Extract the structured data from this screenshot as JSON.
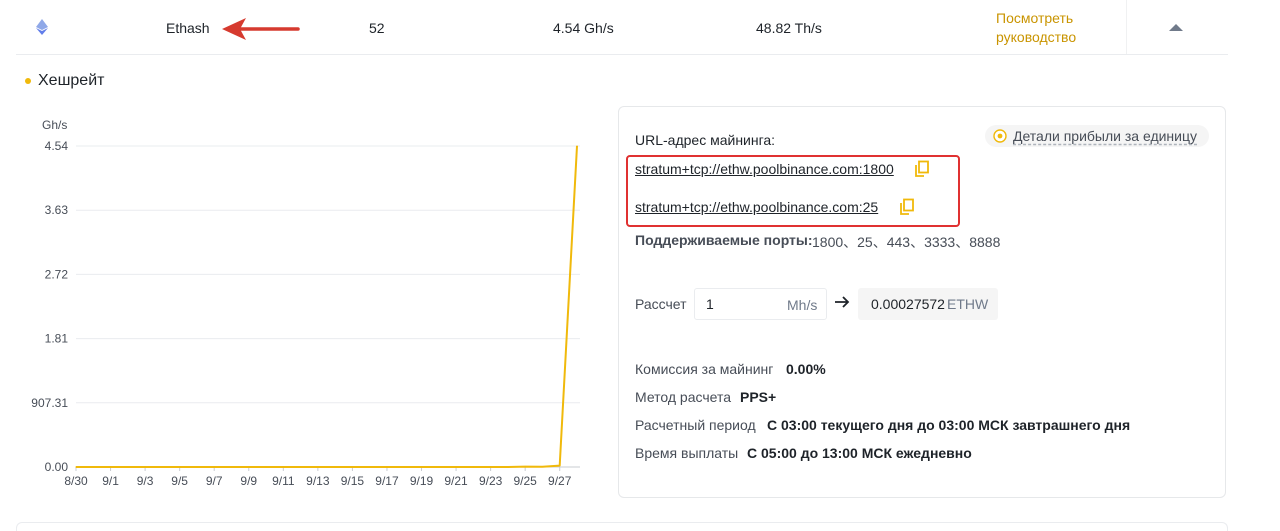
{
  "top_row": {
    "coin_icon": "ethereum-icon",
    "algorithm": "Ethash",
    "workers": "52",
    "hashrate": "4.54 Gh/s",
    "pool_hashrate": "48.82 Th/s",
    "guide_link": "Посмотреть руководство",
    "collapse_icon": "caret-up-icon"
  },
  "section": {
    "title": "Хешрейт"
  },
  "chart_data": {
    "type": "line",
    "ylabel": "Gh/s",
    "y_ticks": [
      "4.54",
      "3.63",
      "2.72",
      "1.81",
      "907.31",
      "0.00"
    ],
    "x_ticks": [
      "8/30",
      "9/1",
      "9/3",
      "9/5",
      "9/7",
      "9/9",
      "9/11",
      "9/13",
      "9/15",
      "9/17",
      "9/19",
      "9/21",
      "9/23",
      "9/25",
      "9/27"
    ],
    "x": [
      "8/30",
      "8/31",
      "9/1",
      "9/2",
      "9/3",
      "9/4",
      "9/5",
      "9/6",
      "9/7",
      "9/8",
      "9/9",
      "9/10",
      "9/11",
      "9/12",
      "9/13",
      "9/14",
      "9/15",
      "9/16",
      "9/17",
      "9/18",
      "9/19",
      "9/20",
      "9/21",
      "9/22",
      "9/23",
      "9/24",
      "9/25",
      "9/26",
      "9/27",
      "9/28"
    ],
    "series": [
      {
        "values": [
          0,
          0,
          0,
          0,
          0,
          0,
          0,
          0,
          0,
          0,
          0,
          0,
          0,
          0,
          0,
          0,
          0,
          0,
          0,
          0,
          0,
          0,
          0,
          0,
          0,
          0,
          0.005,
          0.003,
          0.02,
          4.54
        ],
        "color": "#f0b90b"
      }
    ],
    "ylim": [
      0,
      4.54
    ],
    "grid": true
  },
  "panel": {
    "url_label": "URL-адрес майнинга:",
    "urls": [
      "stratum+tcp://ethw.poolbinance.com:1800",
      "stratum+tcp://ethw.poolbinance.com:25"
    ],
    "ports_label": "Поддерживаемые порты:",
    "ports_value": "1800、25、443、3333、8888",
    "profit_link": "Детали прибыли за единицу",
    "calc_label": "Рассчет",
    "calc_input_value": "1",
    "calc_unit": "Mh/s",
    "calc_result": "0.00027572",
    "calc_currency": "ETHW",
    "fee_label": "Комиссия за майнинг",
    "fee_value": "0.00%",
    "method_label": "Метод расчета",
    "method_value": "PPS+",
    "period_label": "Расчетный период",
    "period_value": "С 03:00 текущего дня до 03:00 МСК завтрашнего дня",
    "payout_label": "Время выплаты",
    "payout_value": "С 05:00 до 13:00 МСК ежедневно"
  },
  "colors": {
    "accent": "#f0b90b",
    "link": "#c99400",
    "highlight": "#e03131",
    "arrow": "#d63a2f"
  }
}
